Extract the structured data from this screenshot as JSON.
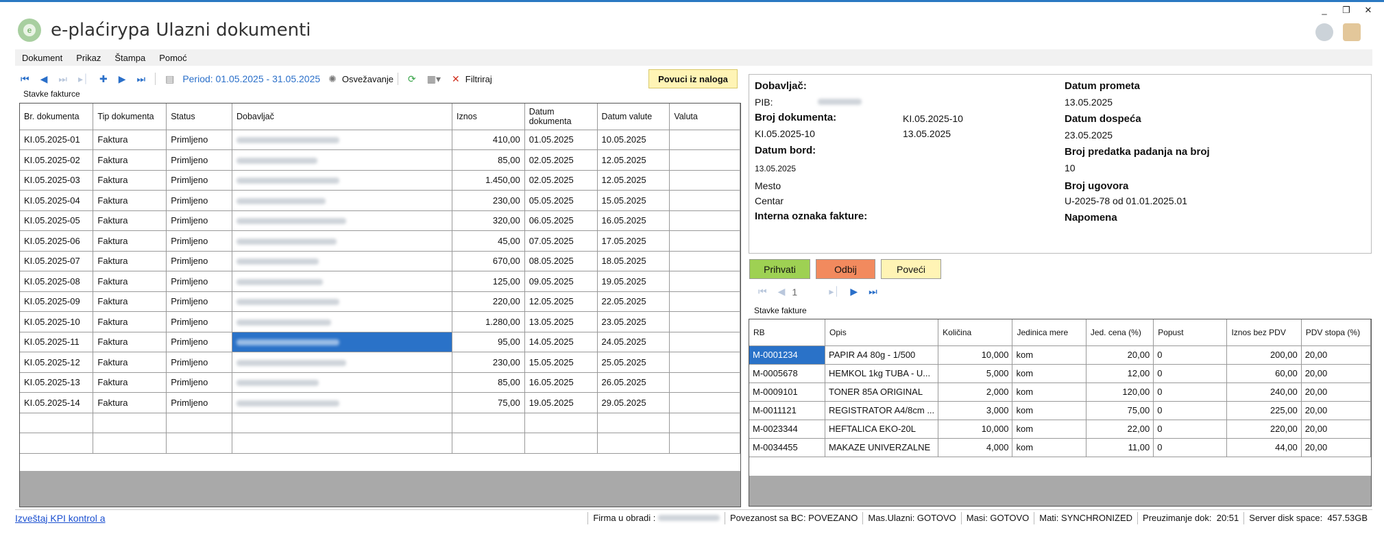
{
  "app": {
    "title": "e-plaćirypa Ulazni dokumenti",
    "logo_letter": "e"
  },
  "window_controls": [
    "_",
    "❐",
    "✕"
  ],
  "menu": [
    "Dokument",
    "Prikaz",
    "Štampa",
    "Pomoć"
  ],
  "toolbar": {
    "period": "Period: 01.05.2025  -  31.05.2025",
    "refresh": "Osvežavanje",
    "filter": "Filtriraj",
    "load_button": "Povuci iz naloga"
  },
  "left_group_label": "Stavke fakturce",
  "left_grid": {
    "columns": [
      "Br. dokumenta",
      "Tip dokumenta",
      "Status",
      "Dobavljač",
      "Iznos",
      "Datum dokumenta",
      "Datum valute",
      "Valuta"
    ],
    "rows": [
      {
        "br": "KI.05.2025-01",
        "tip": "Faktura",
        "status": "Primljeno",
        "iznos": "410,00",
        "datum": "01.05.2025",
        "valuta_datum": "10.05.2025"
      },
      {
        "br": "KI.05.2025-02",
        "tip": "Faktura",
        "status": "Primljeno",
        "iznos": "85,00",
        "datum": "02.05.2025",
        "valuta_datum": "12.05.2025"
      },
      {
        "br": "KI.05.2025-03",
        "tip": "Faktura",
        "status": "Primljeno",
        "iznos": "1.450,00",
        "datum": "02.05.2025",
        "valuta_datum": "12.05.2025"
      },
      {
        "br": "KI.05.2025-04",
        "tip": "Faktura",
        "status": "Primljeno",
        "iznos": "230,00",
        "datum": "05.05.2025",
        "valuta_datum": "15.05.2025"
      },
      {
        "br": "KI.05.2025-05",
        "tip": "Faktura",
        "status": "Primljeno",
        "iznos": "320,00",
        "datum": "06.05.2025",
        "valuta_datum": "16.05.2025"
      },
      {
        "br": "KI.05.2025-06",
        "tip": "Faktura",
        "status": "Primljeno",
        "iznos": "45,00",
        "datum": "07.05.2025",
        "valuta_datum": "17.05.2025"
      },
      {
        "br": "KI.05.2025-07",
        "tip": "Faktura",
        "status": "Primljeno",
        "iznos": "670,00",
        "datum": "08.05.2025",
        "valuta_datum": "18.05.2025"
      },
      {
        "br": "KI.05.2025-08",
        "tip": "Faktura",
        "status": "Primljeno",
        "iznos": "125,00",
        "datum": "09.05.2025",
        "valuta_datum": "19.05.2025"
      },
      {
        "br": "KI.05.2025-09",
        "tip": "Faktura",
        "status": "Primljeno",
        "iznos": "220,00",
        "datum": "12.05.2025",
        "valuta_datum": "22.05.2025"
      },
      {
        "br": "KI.05.2025-10",
        "tip": "Faktura",
        "status": "Primljeno",
        "iznos": "1.280,00",
        "datum": "13.05.2025",
        "valuta_datum": "23.05.2025"
      },
      {
        "br": "KI.05.2025-11",
        "tip": "Faktura",
        "status": "Primljeno",
        "iznos": "95,00",
        "datum": "14.05.2025",
        "valuta_datum": "24.05.2025"
      },
      {
        "br": "KI.05.2025-12",
        "tip": "Faktura",
        "status": "Primljeno",
        "iznos": "230,00",
        "datum": "15.05.2025",
        "valuta_datum": "25.05.2025"
      },
      {
        "br": "KI.05.2025-13",
        "tip": "Faktura",
        "status": "Primljeno",
        "iznos": "85,00",
        "datum": "16.05.2025",
        "valuta_datum": "26.05.2025"
      },
      {
        "br": "KI.05.2025-14",
        "tip": "Faktura",
        "status": "Primljeno",
        "iznos": "75,00",
        "datum": "19.05.2025",
        "valuta_datum": "29.05.2025"
      }
    ]
  },
  "detail": {
    "dobavljac_label": "Dobavljač:",
    "pib_label": "PIB:",
    "broj_dok_label": "Broj dokumenta:",
    "broj_dok_value": "KI.05.2025-10",
    "broj_dok_value2": "KI.05.2025-10",
    "datum_value": "13.05.2025",
    "datum_bord_label": "Datum bord:",
    "datum_bord_value": "13.05.2025",
    "mesto_label": "Mesto",
    "mesto_value": "Centar",
    "interna_label": "Interna oznaka fakture:",
    "datum_prometa_label": "Datum prometa",
    "datum_prometa_value": "13.05.2025",
    "datum_dospeca_label": "Datum dospeća",
    "datum_dospeca_value": "23.05.2025",
    "broj_predatka_label": "Broj predatka padanja na broj",
    "broj_predatka_value": "10",
    "broj_ugovora_label": "Broj ugovora",
    "broj_ugovora_value": "U-2025-78 od 01.01.2025.01",
    "napomena_label": "Napomena"
  },
  "actions": {
    "accept": "Prihvati",
    "reject": "Odbij",
    "enlarge": "Poveći",
    "accept_color": "#9ed153",
    "reject_color": "#f28a5e",
    "enlarge_color": "#fff4b5"
  },
  "right_nav_page": "1",
  "right_group_label": "Stavke fakture",
  "right_grid": {
    "columns": [
      "RB",
      "Opis",
      "Količina",
      "Jedinica mere",
      "Jed. cena (%)",
      "Popust",
      "Iznos bez PDV",
      "PDV stopa (%)"
    ],
    "rows": [
      {
        "rb": "M-0001234",
        "opis": "PAPIR A4 80g - 1/500",
        "kol": "10,000",
        "jm": "kom",
        "cena": "20,00",
        "popust": "0",
        "iznos": "200,00",
        "pdv": "20,00"
      },
      {
        "rb": "M-0005678",
        "opis": "HEMKOL 1kg TUBA - U...",
        "kol": "5,000",
        "jm": "kom",
        "cena": "12,00",
        "popust": "0",
        "iznos": "60,00",
        "pdv": "20,00"
      },
      {
        "rb": "M-0009101",
        "opis": "TONER 85A ORIGINAL",
        "kol": "2,000",
        "jm": "kom",
        "cena": "120,00",
        "popust": "0",
        "iznos": "240,00",
        "pdv": "20,00"
      },
      {
        "rb": "M-0011121",
        "opis": "REGISTRATOR A4/8cm ...",
        "kol": "3,000",
        "jm": "kom",
        "cena": "75,00",
        "popust": "0",
        "iznos": "225,00",
        "pdv": "20,00"
      },
      {
        "rb": "M-0023344",
        "opis": "HEFTALICA EKO-20L",
        "kol": "10,000",
        "jm": "kom",
        "cena": "22,00",
        "popust": "0",
        "iznos": "220,00",
        "pdv": "20,00"
      },
      {
        "rb": "M-0034455",
        "opis": "MAKAZE UNIVERZALNE",
        "kol": "4,000",
        "jm": "kom",
        "cena": "11,00",
        "popust": "0",
        "iznos": "44,00",
        "pdv": "20,00"
      }
    ]
  },
  "status": {
    "kpi_link": "Izveštaj KPI kontrol a",
    "firma": "Firma u obradi :",
    "bc": "Povezanost sa BC: POVEZANO",
    "mas_ulazni": "Mas.Ulazni: GOTOVO",
    "masi": "Masi: GOTOVO",
    "mati": "Mati: SYNCHRONIZED",
    "preuzimanje_label": "Preuzimanje dok:",
    "preuzimanje_time": "20:51",
    "disk_label": "Server disk space:",
    "disk_value": "457.53GB"
  }
}
